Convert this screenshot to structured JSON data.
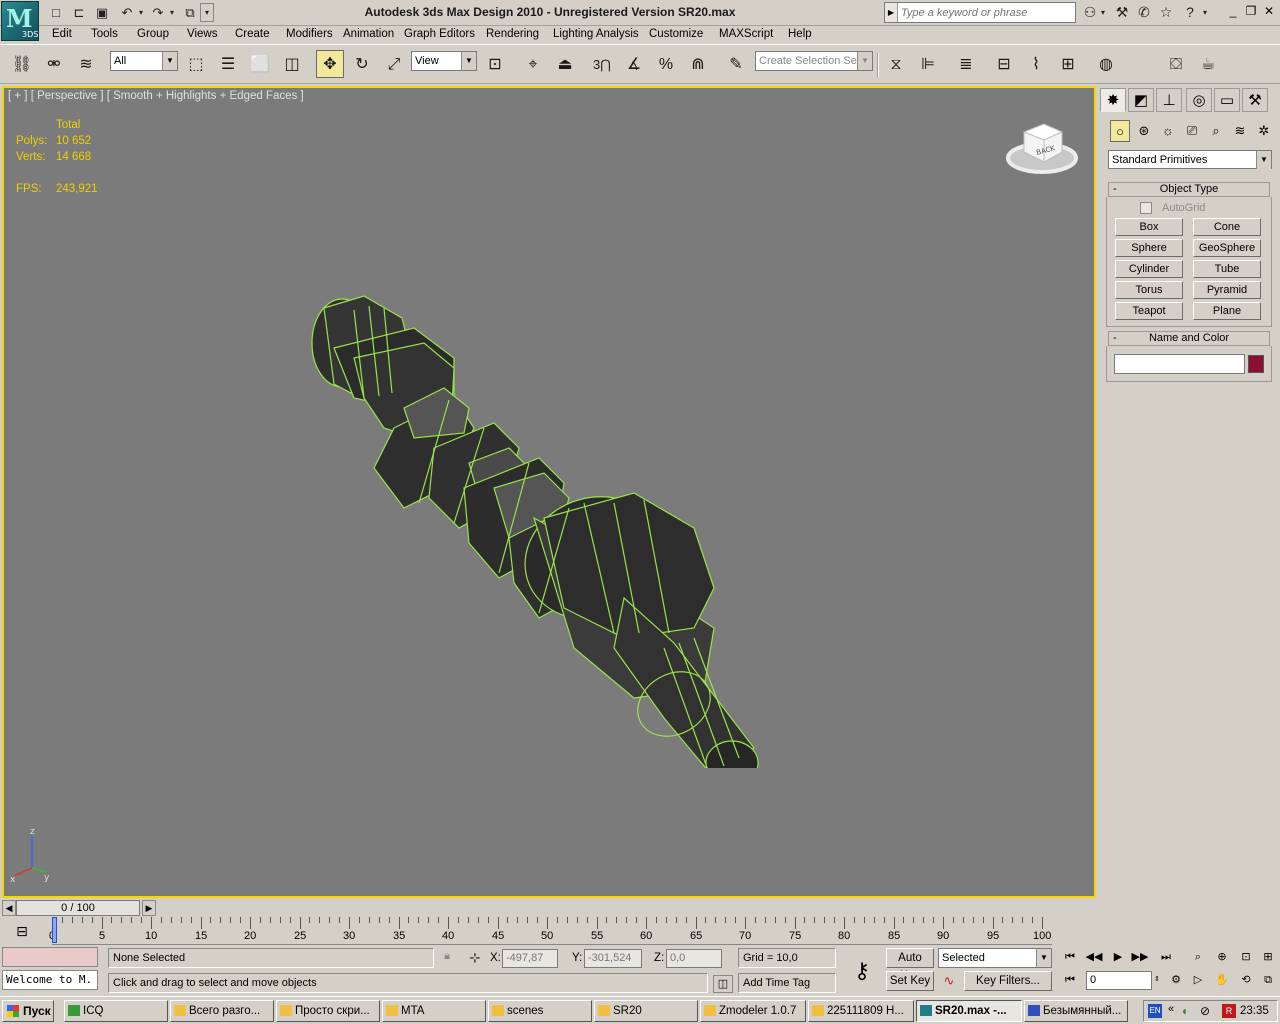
{
  "title_bar": {
    "app_logo_letter": "M",
    "app_logo_sub": "3DS",
    "window_title": "Autodesk 3ds Max Design 2010  - Unregistered Version   SR20.max",
    "search_placeholder": "Type a keyword or phrase"
  },
  "menu": [
    "Edit",
    "Tools",
    "Group",
    "Views",
    "Create",
    "Modifiers",
    "Animation",
    "Graph Editors",
    "Rendering",
    "Lighting Analysis",
    "Customize",
    "MAXScript",
    "Help"
  ],
  "toolbar": {
    "selection_filter": "All",
    "ref_coord": "View",
    "named_selection_placeholder": "Create Selection Se",
    "snap_label": "3"
  },
  "viewport": {
    "label": "[ + ] [ Perspective ] [ Smooth + Highlights + Edged Faces ]",
    "stats": {
      "header": "Total",
      "polys_label": "Polys:",
      "polys_value": "10 652",
      "verts_label": "Verts:",
      "verts_value": "14 668",
      "fps_label": "FPS:",
      "fps_value": "243,921"
    },
    "viewcube_label": "BACK",
    "axis": {
      "z": "z",
      "x": "x",
      "y": "y"
    },
    "colors": {
      "background": "#7b7b7b",
      "border": "#f5d800",
      "wire": "#9be24a",
      "stats": "#f0d000"
    }
  },
  "command_panel": {
    "category": "Standard Primitives",
    "object_type_title": "Object Type",
    "autogrid_label": "AutoGrid",
    "primitives": [
      "Box",
      "Cone",
      "Sphere",
      "GeoSphere",
      "Cylinder",
      "Tube",
      "Torus",
      "Pyramid",
      "Teapot",
      "Plane"
    ],
    "name_color_title": "Name and Color",
    "object_name": "",
    "object_color": "#8b0e2e"
  },
  "time_slider": {
    "frame_display": "0 / 100",
    "ticks": [
      "0",
      "5",
      "10",
      "15",
      "20",
      "25",
      "30",
      "35",
      "40",
      "45",
      "50",
      "55",
      "60",
      "65",
      "70",
      "75",
      "80",
      "85",
      "90",
      "95",
      "100"
    ]
  },
  "status": {
    "maxscript_text": "Welcome to M.",
    "selection": "None Selected",
    "prompt": "Click and drag to select and move objects",
    "x_label": "X:",
    "x_value": "-497,87",
    "y_label": "Y:",
    "y_value": "-301,524",
    "z_label": "Z:",
    "z_value": "0,0",
    "grid": "Grid = 10,0",
    "add_time_tag": "Add Time Tag",
    "auto_key": "Auto Key",
    "set_key": "Set Key",
    "key_mode": "Selected",
    "key_filters": "Key Filters...",
    "current_frame": "0"
  },
  "taskbar": {
    "start": "Пуск",
    "tasks": [
      {
        "label": "ICQ",
        "color": "#3a9a3a"
      },
      {
        "label": "Всего разго...",
        "color": "#f0c040"
      },
      {
        "label": "Просто скри...",
        "color": "#f0c040"
      },
      {
        "label": "MTA",
        "color": "#f0c040"
      },
      {
        "label": "scenes",
        "color": "#f0c040"
      },
      {
        "label": "SR20",
        "color": "#f0c040"
      },
      {
        "label": "Zmodeler 1.0.7",
        "color": "#f0c040"
      },
      {
        "label": "225111809 Н...",
        "color": "#f0c040"
      },
      {
        "label": "SR20.max -...",
        "color": "#1f7f86"
      },
      {
        "label": "Безымянный...",
        "color": "#3050c0"
      }
    ],
    "lang": "EN",
    "clock": "23:35"
  }
}
